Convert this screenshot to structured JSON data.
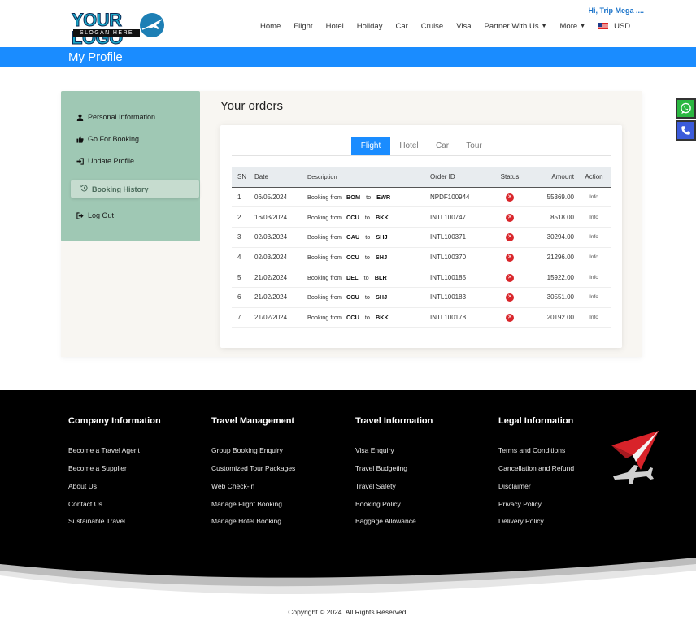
{
  "header": {
    "logo_text": "YOUR LOGO",
    "logo_slogan": "SLOGAN HERE",
    "greeting": "Hi, Trip Mega ....",
    "nav": [
      "Home",
      "Flight",
      "Hotel",
      "Holiday",
      "Car",
      "Cruise",
      "Visa"
    ],
    "partner_label": "Partner With Us",
    "more_label": "More",
    "currency": "USD"
  },
  "profile_bar": {
    "title": "My Profile"
  },
  "sidebar": {
    "personal": "Personal Information",
    "booking": "Go For Booking",
    "update": "Update Profile",
    "history": "Booking History",
    "logout": "Log Out"
  },
  "orders": {
    "title": "Your orders",
    "tabs": [
      "Flight",
      "Hotel",
      "Car",
      "Tour"
    ],
    "active_tab": "Flight",
    "columns": {
      "sn": "SN",
      "date": "Date",
      "description": "Description",
      "order_id": "Order ID",
      "status": "Status",
      "amount": "Amount",
      "action": "Action"
    },
    "desc_prefix": "Booking from",
    "desc_to": "to",
    "action_label": "Info",
    "rows": [
      {
        "sn": "1",
        "date": "06/05/2024",
        "from": "BOM",
        "to": "EWR",
        "order_id": "NPDF100944",
        "amount": "55369.00"
      },
      {
        "sn": "2",
        "date": "16/03/2024",
        "from": "CCU",
        "to": "BKK",
        "order_id": "INTL100747",
        "amount": "8518.00"
      },
      {
        "sn": "3",
        "date": "02/03/2024",
        "from": "GAU",
        "to": "SHJ",
        "order_id": "INTL100371",
        "amount": "30294.00"
      },
      {
        "sn": "4",
        "date": "02/03/2024",
        "from": "CCU",
        "to": "SHJ",
        "order_id": "INTL100370",
        "amount": "21296.00"
      },
      {
        "sn": "5",
        "date": "21/02/2024",
        "from": "DEL",
        "to": "BLR",
        "order_id": "INTL100185",
        "amount": "15922.00"
      },
      {
        "sn": "6",
        "date": "21/02/2024",
        "from": "CCU",
        "to": "SHJ",
        "order_id": "INTL100183",
        "amount": "30551.00"
      },
      {
        "sn": "7",
        "date": "21/02/2024",
        "from": "CCU",
        "to": "BKK",
        "order_id": "INTL100178",
        "amount": "20192.00"
      }
    ]
  },
  "footer": {
    "columns": [
      {
        "title": "Company Information",
        "links": [
          "Become a Travel Agent",
          "Become a Supplier",
          "About Us",
          "Contact Us",
          "Sustainable Travel"
        ]
      },
      {
        "title": "Travel Management",
        "links": [
          "Group Booking Enquiry",
          "Customized Tour Packages",
          "Web Check-in",
          "Manage Flight Booking",
          "Manage Hotel Booking"
        ]
      },
      {
        "title": "Travel Information",
        "links": [
          "Visa Enquiry",
          "Travel Budgeting",
          "Travel Safety",
          "Booking Policy",
          "Baggage Allowance"
        ]
      },
      {
        "title": "Legal Information",
        "links": [
          "Terms and Conditions",
          "Cancellation and Refund",
          "Disclaimer",
          "Privacy Policy",
          "Delivery Policy"
        ]
      }
    ],
    "copyright": "Copyright © 2024. All Rights Reserved."
  },
  "colors": {
    "accent": "#1a8cff",
    "sidebar": "#9fc8b4",
    "status_cancelled": "#d9262b",
    "greeting": "#1a73c9"
  }
}
